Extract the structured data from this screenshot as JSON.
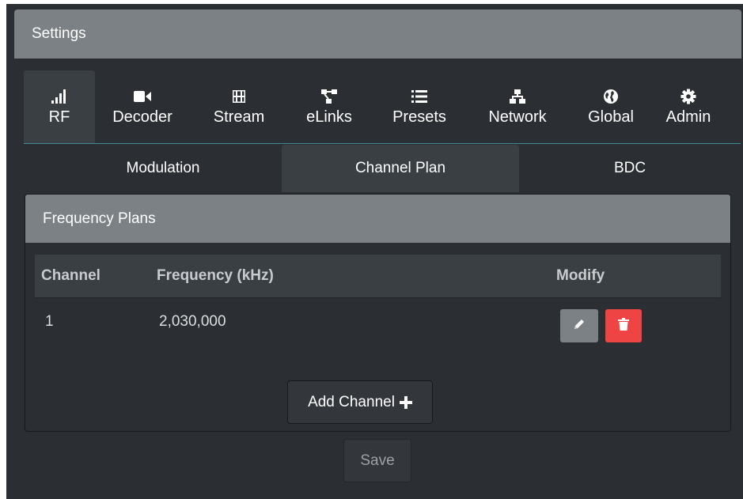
{
  "header": {
    "title": "Settings"
  },
  "main_nav": [
    {
      "label": "RF",
      "icon": "signal-bars-icon",
      "active": true
    },
    {
      "label": "Decoder",
      "icon": "video-camera-icon",
      "active": false
    },
    {
      "label": "Stream",
      "icon": "film-icon",
      "active": false
    },
    {
      "label": "eLinks",
      "icon": "diagram-link-icon",
      "active": false
    },
    {
      "label": "Presets",
      "icon": "list-icon",
      "active": false
    },
    {
      "label": "Network",
      "icon": "network-sitemap-icon",
      "active": false
    },
    {
      "label": "Global",
      "icon": "globe-icon",
      "active": false
    },
    {
      "label": "Admin",
      "icon": "gear-icon",
      "active": false
    }
  ],
  "sub_tabs": [
    {
      "label": "Modulation",
      "active": false
    },
    {
      "label": "Channel Plan",
      "active": true
    },
    {
      "label": "BDC",
      "active": false
    }
  ],
  "panel": {
    "title": "Frequency Plans",
    "columns": {
      "channel": "Channel",
      "frequency": "Frequency (kHz)",
      "modify": "Modify"
    },
    "rows": [
      {
        "channel": "1",
        "frequency": "2,030,000"
      }
    ],
    "add_channel_label": "Add Channel"
  },
  "footer": {
    "save_label": "Save"
  },
  "colors": {
    "background": "#2b2e32",
    "header": "#7c8185",
    "active_tab": "#3a3f44",
    "delete": "#ee4444",
    "accent_line": "#3e8a93"
  }
}
